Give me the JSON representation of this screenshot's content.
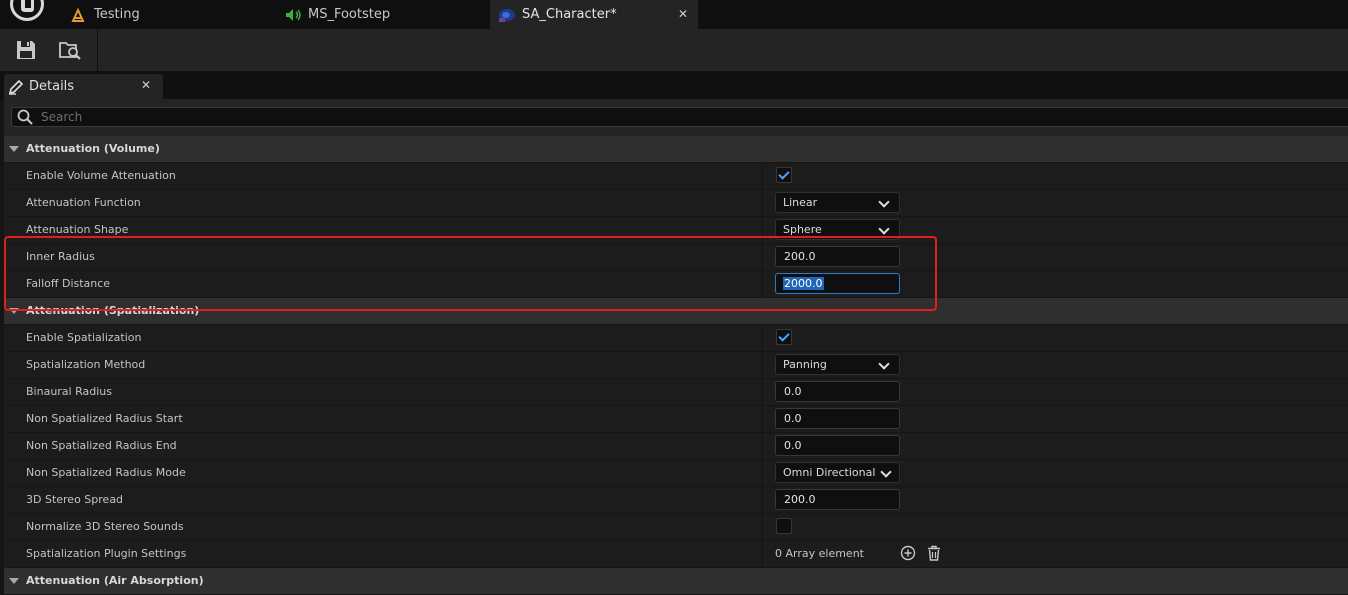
{
  "tabs": [
    {
      "label": "Testing",
      "icon": "level-icon"
    },
    {
      "label": "MS_Footstep",
      "icon": "metasound-icon"
    },
    {
      "label": "SA_Character*",
      "icon": "sound-attenuation-icon",
      "active": true
    }
  ],
  "toolbar": {
    "buttons": [
      "save-icon",
      "browse-icon"
    ]
  },
  "panel": {
    "title": "Details"
  },
  "search": {
    "placeholder": "Search"
  },
  "sections": {
    "volume": {
      "title": "Attenuation (Volume)",
      "enable_volume_attenuation": {
        "label": "Enable Volume Attenuation",
        "checked": true
      },
      "attenuation_function": {
        "label": "Attenuation Function",
        "value": "Linear"
      },
      "attenuation_shape": {
        "label": "Attenuation Shape",
        "value": "Sphere"
      },
      "inner_radius": {
        "label": "Inner Radius",
        "value": "200.0"
      },
      "falloff_distance": {
        "label": "Falloff Distance",
        "value": "2000.0"
      }
    },
    "spatialization": {
      "title": "Attenuation (Spatialization)",
      "enable_spatialization": {
        "label": "Enable Spatialization",
        "checked": true
      },
      "spatialization_method": {
        "label": "Spatialization Method",
        "value": "Panning"
      },
      "binaural_radius": {
        "label": "Binaural Radius",
        "value": "0.0"
      },
      "non_spat_radius_start": {
        "label": "Non Spatialized Radius Start",
        "value": "0.0"
      },
      "non_spat_radius_end": {
        "label": "Non Spatialized Radius End",
        "value": "0.0"
      },
      "non_spat_radius_mode": {
        "label": "Non Spatialized Radius Mode",
        "value": "Omni Directional"
      },
      "stereo_spread": {
        "label": "3D Stereo Spread",
        "value": "200.0"
      },
      "normalize_stereo": {
        "label": "Normalize 3D Stereo Sounds",
        "checked": false
      },
      "plugin_settings": {
        "label": "Spatialization Plugin Settings",
        "value": "0 Array element"
      }
    },
    "air_absorption": {
      "title": "Attenuation (Air Absorption)"
    }
  },
  "colors": {
    "accent": "#4aa3ff",
    "highlight_box": "#e0201a",
    "selection": "#2066b8"
  }
}
